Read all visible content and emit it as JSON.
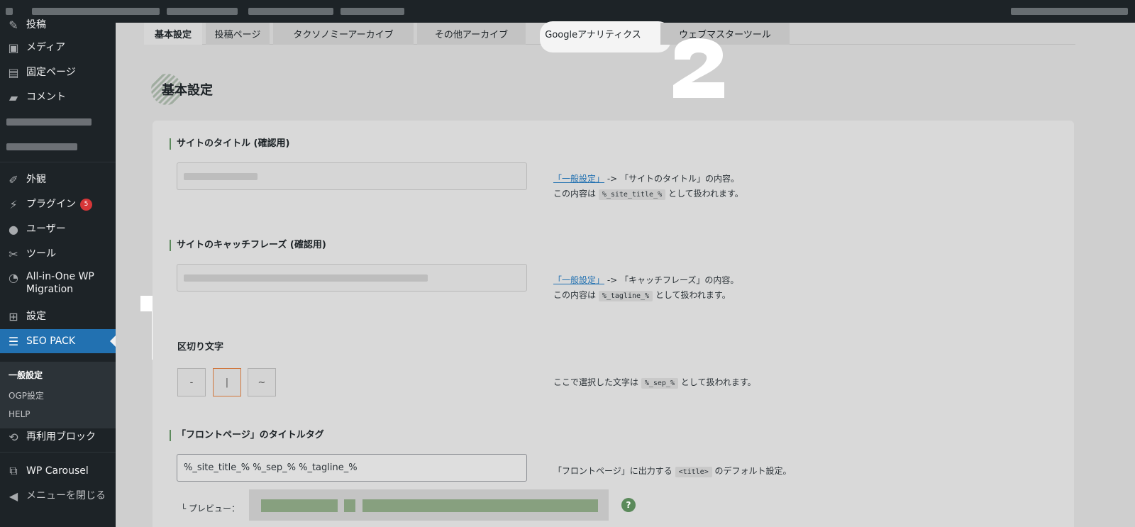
{
  "sidebar": {
    "items": [
      {
        "label": "投稿",
        "icon": "pin-icon"
      },
      {
        "label": "メディア",
        "icon": "media-icon"
      },
      {
        "label": "固定ページ",
        "icon": "page-icon"
      },
      {
        "label": "コメント",
        "icon": "comment-icon"
      },
      {
        "label": "外観",
        "icon": "brush-icon"
      },
      {
        "label": "プラグイン",
        "icon": "plugin-icon",
        "badge": "5"
      },
      {
        "label": "ユーザー",
        "icon": "user-icon"
      },
      {
        "label": "ツール",
        "icon": "wrench-icon"
      },
      {
        "label": "All-in-One WP Migration",
        "icon": "migration-icon"
      },
      {
        "label": "設定",
        "icon": "settings-icon"
      },
      {
        "label": "SEO PACK",
        "icon": "list-icon"
      },
      {
        "label": "再利用ブロック",
        "icon": "reuse-icon"
      },
      {
        "label": "WP Carousel",
        "icon": "carousel-icon"
      },
      {
        "label": "メニューを閉じる",
        "icon": "collapse-icon"
      }
    ],
    "submenu": [
      "一般設定",
      "OGP設定",
      "HELP"
    ]
  },
  "tabs": [
    "基本設定",
    "投稿ページ",
    "タクソノミーアーカイブ",
    "その他アーカイブ",
    "Googleアナリティクス",
    "ウェブマスターツール"
  ],
  "annotations": {
    "one": "1",
    "two": "2"
  },
  "section": {
    "title": "基本設定"
  },
  "fields": {
    "site_title": {
      "label": "サイトのタイトル (確認用)",
      "desc_link": "「一般設定」",
      "desc_rest": " -> 「サイトのタイトル」の内容。",
      "desc2_pre": "この内容は ",
      "desc2_code": "%_site_title_%",
      "desc2_post": " として扱われます。"
    },
    "tagline": {
      "label": "サイトのキャッチフレーズ (確認用)",
      "desc_link": "「一般設定」",
      "desc_rest": " -> 「キャッチフレーズ」の内容。",
      "desc2_pre": "この内容は ",
      "desc2_code": "%_tagline_%",
      "desc2_post": " として扱われます。"
    },
    "separator": {
      "label": "区切り文字",
      "options": [
        "-",
        "|",
        "~"
      ],
      "selected": "|",
      "desc_pre": "ここで選択した文字は ",
      "desc_code": "%_sep_%",
      "desc_post": " として扱われます。"
    },
    "front_title": {
      "label": "「フロントページ」のタイトルタグ",
      "value": "%_site_title_% %_sep_% %_tagline_%",
      "desc_pre": "「フロントページ」に出力する ",
      "desc_code": "<title>",
      "desc_post": " のデフォルト設定。",
      "preview_label": "└ プレビュー：",
      "help": "?"
    }
  },
  "colors": {
    "accent": "#2271b1",
    "sidebar_bg": "#1d2327",
    "badge": "#d63638",
    "selected_border": "#d0763b"
  }
}
